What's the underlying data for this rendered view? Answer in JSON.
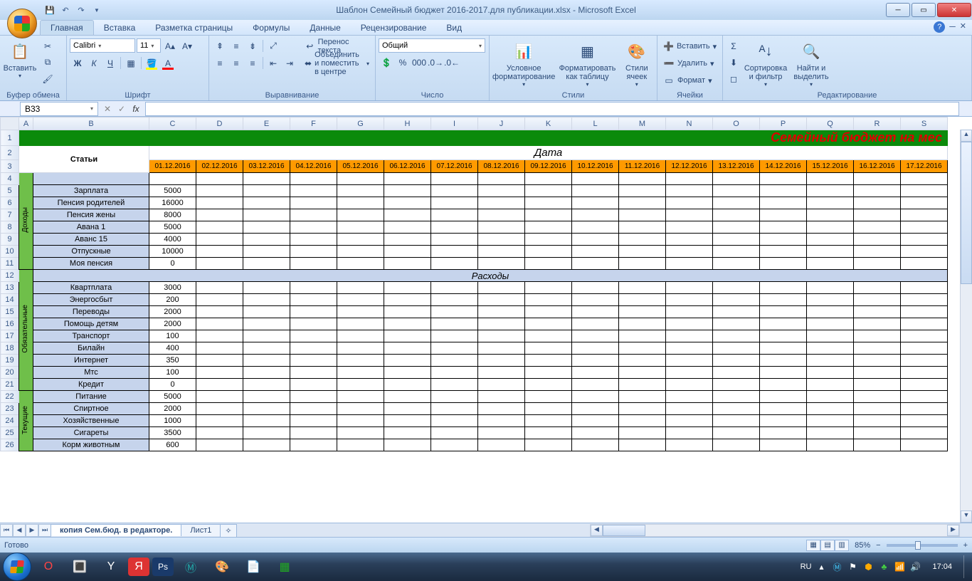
{
  "title": "Шаблон Семейный бюджет 2016-2017.для публикации.xlsx - Microsoft Excel",
  "tabs": [
    "Главная",
    "Вставка",
    "Разметка страницы",
    "Формулы",
    "Данные",
    "Рецензирование",
    "Вид"
  ],
  "ribbon": {
    "clipboard": {
      "paste": "Вставить",
      "label": "Буфер обмена"
    },
    "font": {
      "name": "Calibri",
      "size": "11",
      "label": "Шрифт",
      "bold": "Ж",
      "italic": "К",
      "underline": "Ч"
    },
    "align": {
      "wrap": "Перенос текста",
      "merge": "Объединить и поместить в центре",
      "label": "Выравнивание"
    },
    "number": {
      "format": "Общий",
      "label": "Число"
    },
    "styles": {
      "cond": "Условное форматирование",
      "fmt": "Форматировать как таблицу",
      "cell": "Стили ячеек",
      "label": "Стили"
    },
    "cells": {
      "ins": "Вставить",
      "del": "Удалить",
      "fmt": "Формат",
      "label": "Ячейки"
    },
    "edit": {
      "sort": "Сортировка и фильтр",
      "find": "Найти и выделить",
      "label": "Редактирование"
    }
  },
  "name_box": "B33",
  "columns": [
    "A",
    "B",
    "C",
    "D",
    "E",
    "F",
    "G",
    "H",
    "I",
    "J",
    "K",
    "L",
    "M",
    "N",
    "O",
    "P",
    "Q",
    "R",
    "S"
  ],
  "banner_title": "Семейный бюджет на мес",
  "stat_header": "Статьи",
  "date_header": "Дата",
  "dates": [
    "01.12.2016",
    "02.12.2016",
    "03.12.2016",
    "04.12.2016",
    "05.12.2016",
    "06.12.2016",
    "07.12.2016",
    "08.12.2016",
    "09.12.2016",
    "10.12.2016",
    "11.12.2016",
    "12.12.2016",
    "13.12.2016",
    "14.12.2016",
    "15.12.2016",
    "16.12.2016",
    "17.12.2016"
  ],
  "sections": {
    "income_label": "Доходы",
    "mandatory_label": "Обязательные",
    "current_label": "Текущие",
    "expenses_label": "Расходы"
  },
  "income": [
    {
      "name": "Зарплата",
      "val": "5000"
    },
    {
      "name": "Пенсия родителей",
      "val": "16000"
    },
    {
      "name": "Пенсия жены",
      "val": "8000"
    },
    {
      "name": "Авана 1",
      "val": "5000"
    },
    {
      "name": "Аванс 15",
      "val": "4000"
    },
    {
      "name": "Отпускные",
      "val": "10000"
    },
    {
      "name": "Моя пенсия",
      "val": "0"
    }
  ],
  "mandatory": [
    {
      "name": "Квартплата",
      "val": "3000"
    },
    {
      "name": "Энергосбыт",
      "val": "200"
    },
    {
      "name": "Переводы",
      "val": "2000"
    },
    {
      "name": "Помощь детям",
      "val": "2000"
    },
    {
      "name": "Транспорт",
      "val": "100"
    },
    {
      "name": "Билайн",
      "val": "400"
    },
    {
      "name": "Интернет",
      "val": "350"
    },
    {
      "name": "Мтс",
      "val": "100"
    },
    {
      "name": "Кредит",
      "val": "0"
    }
  ],
  "current": [
    {
      "name": "Питание",
      "val": "5000"
    },
    {
      "name": "Спиртное",
      "val": "2000"
    },
    {
      "name": "Хозяйственные",
      "val": "1000"
    },
    {
      "name": "Сигареты",
      "val": "3500"
    },
    {
      "name": "Корм животным",
      "val": "600"
    }
  ],
  "sheet_tabs": {
    "t1": "копия Сем.бюд. в редакторе.",
    "t2": "Лист1"
  },
  "status": {
    "ready": "Готово",
    "zoom": "85%"
  },
  "tray": {
    "lang": "RU",
    "time": "17:04"
  }
}
